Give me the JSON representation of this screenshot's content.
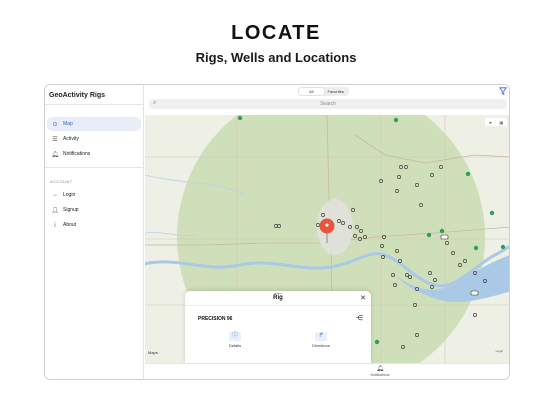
{
  "promo": {
    "headline": "LOCATE",
    "subheadline": "Rigs, Wells and Locations"
  },
  "app": {
    "title": "GeoActivity Rigs"
  },
  "sidebar": {
    "items": [
      {
        "label": "Map",
        "icon": "map-icon",
        "active": true
      },
      {
        "label": "Activity",
        "icon": "list-icon",
        "active": false
      },
      {
        "label": "Notifications",
        "icon": "bell-icon",
        "active": false
      }
    ],
    "account_section": "ACCOUNT",
    "account_items": [
      {
        "label": "Login",
        "icon": "login-icon"
      },
      {
        "label": "Signup",
        "icon": "signup-icon"
      },
      {
        "label": "About",
        "icon": "info-icon"
      }
    ]
  },
  "topbar": {
    "segments": [
      "All",
      "Favorites"
    ],
    "selected_segment": "All",
    "search_placeholder": "Search"
  },
  "map": {
    "attribution": "Maps",
    "legal": "Legal",
    "selected_pin_color": "#e8553d",
    "well_marker_color": "#2f9e5b",
    "river_color": "#a9c9e6",
    "radius_fill_color": "#c9dcb2"
  },
  "sheet": {
    "title": "Rig",
    "rig_name": "PRECISION 96",
    "actions": [
      {
        "label": "Details",
        "icon": "info-icon"
      },
      {
        "label": "Directions",
        "icon": "directions-icon"
      }
    ]
  },
  "tabbar": {
    "notifications_label": "Notifications"
  },
  "colors": {
    "accent": "#2a64d6",
    "active_bg": "#e9edf7"
  }
}
